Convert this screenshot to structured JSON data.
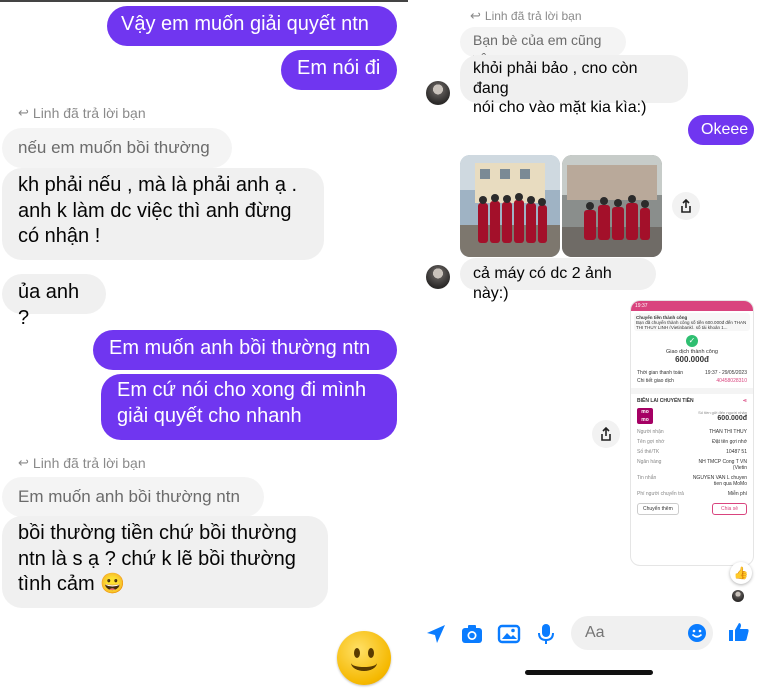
{
  "left": {
    "messages": {
      "sent_1": "Vậy em muốn giải quyết ntn",
      "sent_2": "Em nói đi",
      "reply_note_1": "Linh đã trả lời bạn",
      "quoted_1": "nếu em muốn bồi thường",
      "recv_1": "kh phải nếu , mà là phải anh ạ .\nanh k làm dc việc thì anh đừng\ncó nhận !",
      "recv_2": "ủa anh ?",
      "sent_3": "Em muốn anh bồi thường ntn",
      "sent_4": "Em cứ nói cho xong đi mình\ngiải quyết cho nhanh",
      "reply_note_2": "Linh đã trả lời bạn",
      "quoted_2": "Em muốn anh bồi thường ntn",
      "recv_3": "bồi thường tiền chứ bồi thường\nntn là s ạ ? chứ k lẽ bồi thường\ntình cảm 😀"
    }
  },
  "right": {
    "reply_note": "Linh đã trả lời bạn",
    "quoted": "Bạn bè của em cũng vậy",
    "recv_1": "khỏi phải bảo , cno còn đang\nnói cho vào mặt kia kìa:)",
    "sent_1": "Okeee",
    "recv_2": "cả máy có dc 2 ảnh này:)",
    "receipt": {
      "notif_title": "Chuyển tiền thành công",
      "notif_body": "Bạn đã chuyển thành công số tiền 600.000đ đến THAN THI THUY LINH (Vietinbank), số tài khoản 1...",
      "status": "Giao dịch thành công",
      "amount": "600.000đ",
      "time_label": "Thời gian thanh toán",
      "time_value": "19:37 - 29/05/2023",
      "detail_label": "Chi tiết giao dịch",
      "detail_value": "40458028310",
      "section": "BIÊN LAI CHUYỂN TIỀN",
      "brand": "mo mo",
      "sent_amount_label": "Số tiền gửi đến người nhận",
      "sent_amount": "600.000đ",
      "rows": [
        {
          "k": "Người nhận",
          "v": "THAN THI THUY"
        },
        {
          "k": "Tên gợi nhớ",
          "v": "Đặt tên gợi nhớ"
        },
        {
          "k": "Số thẻ/TK",
          "v": "10487 51"
        },
        {
          "k": "Ngân hàng",
          "v": "NH TMCP Cong T VN (Vietin"
        },
        {
          "k": "Tin nhắn",
          "v": "NGUYEN VAN L chuyen tien qua MoMo"
        },
        {
          "k": "Phí người chuyển trả",
          "v": "Miễn phí"
        }
      ],
      "btn_transfer": "Chuyển thêm",
      "btn_share": "Chia sẻ",
      "clock": "19:37"
    },
    "composer_placeholder": "Aa"
  },
  "colors": {
    "sent_bubble": "#7036f0",
    "recv_bubble": "#f0f0f0",
    "accent": "#0a7cff",
    "momo": "#a50064"
  }
}
